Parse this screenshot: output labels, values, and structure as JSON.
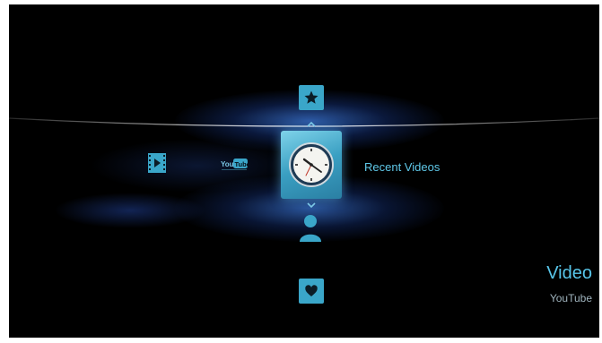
{
  "menu": {
    "up_item_icon": "star-icon",
    "selected_item": {
      "icon": "clock-icon",
      "label": "Recent Videos"
    },
    "down_item_icon": "person-icon",
    "bottom_item_icon": "heart-icon"
  },
  "left_items": [
    {
      "icon": "film-icon"
    },
    {
      "icon": "youtube-logo",
      "text": "YouTube"
    }
  ],
  "section": {
    "title": "Video",
    "subtitle": "YouTube"
  },
  "colors": {
    "accent": "#3aa6c9",
    "background": "#000000",
    "text_accent": "#5fc8e8"
  }
}
